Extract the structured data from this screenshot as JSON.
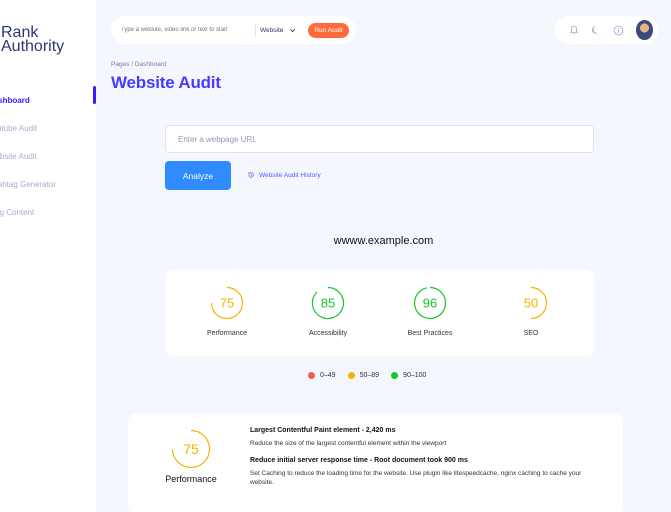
{
  "app": {
    "brand": "Rank Authority"
  },
  "sidebar": {
    "items": [
      {
        "label": "Dashboard",
        "active": true
      },
      {
        "label": "Youtube Audit"
      },
      {
        "label": "Website Audit"
      },
      {
        "label": "Hashtag Generator"
      },
      {
        "label": "Blog Content"
      }
    ]
  },
  "header": {
    "search_placeholder": "Type a website, video link or text to start",
    "select_value": "Website",
    "run_label": "Run Audit",
    "breadcrumb": "Pages / Dashboard",
    "page_title": "Website Audit"
  },
  "audit": {
    "url_placeholder": "Enter a webpage URL",
    "analyze_label": "Analyze",
    "history_label": "Website Audit History",
    "domain": "wwww.example.com"
  },
  "scores": [
    {
      "label": "Performance",
      "value": "75",
      "color": "#f6b400"
    },
    {
      "label": "Accessibility",
      "value": "85",
      "color": "#19c32c"
    },
    {
      "label": "Best Practices",
      "value": "96",
      "color": "#19c32c"
    },
    {
      "label": "SEO",
      "value": "50",
      "color": "#f6b400"
    }
  ],
  "legend": [
    {
      "label": "0–49",
      "color": "#f25c54"
    },
    {
      "label": "50–89",
      "color": "#f6b400"
    },
    {
      "label": "90–100",
      "color": "#19c32c"
    }
  ],
  "detail": {
    "score": "75",
    "label": "Performance",
    "items": [
      {
        "title": "Largest Contentful Paint element - 2,420 ms",
        "desc": "Reduce the size of the largest contentful element within the viewport"
      },
      {
        "title": "Reduce initial server response time -  Root document took 900 ms",
        "desc": "Set Caching to reduce the loading time for the website. Use plugin like litespeedcache, nginx caching to cache your website."
      }
    ]
  }
}
